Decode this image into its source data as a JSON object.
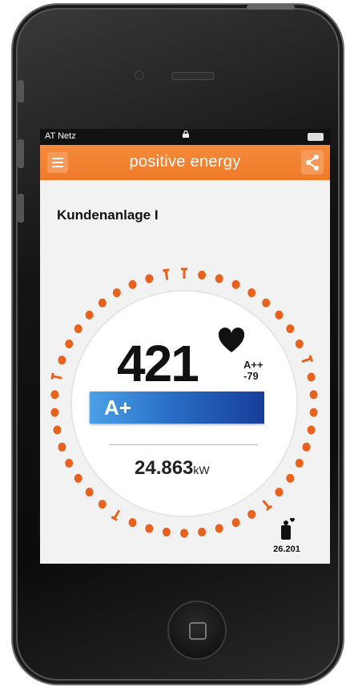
{
  "status_bar": {
    "carrier": "AT Netz"
  },
  "app_bar": {
    "title": "positive energy"
  },
  "plant": {
    "name": "Kundenanlage I"
  },
  "gauge": {
    "score": "421",
    "rank_prefix": "A++",
    "rank_delta": "-79",
    "energy_class": "A+",
    "power_value": "24.863",
    "power_unit": "kW",
    "accent_color": "#e8621d",
    "bar_color": "#2a6fc8"
  },
  "community": {
    "count": "26.201"
  },
  "icons": [
    "menu-icon",
    "share-icon",
    "heart-icon",
    "lock-icon",
    "battery-icon",
    "signal-icon",
    "community-icon",
    "home-button"
  ]
}
